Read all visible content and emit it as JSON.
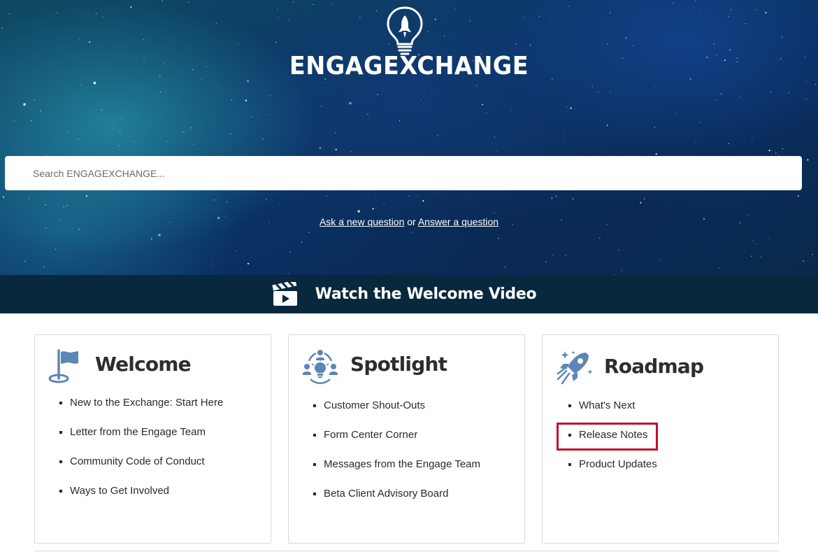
{
  "brand": {
    "logo_text": "ENGAGEXCHANGE"
  },
  "search": {
    "placeholder": "Search ENGAGEXCHANGE..."
  },
  "ask": {
    "ask_link": "Ask a new question",
    "separator": "or",
    "answer_link": "Answer a question"
  },
  "video": {
    "label": "Watch the Welcome Video"
  },
  "cards": [
    {
      "title": "Welcome",
      "icon": "flag-icon",
      "items": [
        "New to the Exchange: Start Here",
        "Letter from the Engage Team",
        "Community Code of Conduct",
        "Ways to Get Involved"
      ]
    },
    {
      "title": "Spotlight",
      "icon": "community-lightbulb-icon",
      "items": [
        "Customer Shout-Outs",
        "Form Center Corner",
        "Messages from the Engage Team",
        "Beta Client Advisory Board"
      ]
    },
    {
      "title": "Roadmap",
      "icon": "rocket-icon",
      "items": [
        "What's Next",
        "Release Notes",
        "Product Updates"
      ]
    }
  ],
  "colors": {
    "accent_icon": "#5b86b5",
    "highlight_border": "#c0102b",
    "video_band": "#07283d"
  }
}
